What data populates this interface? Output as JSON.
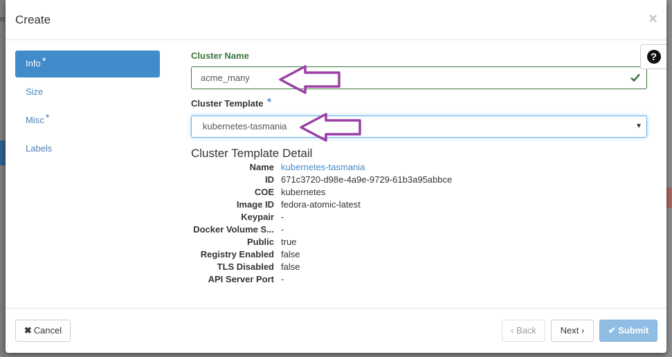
{
  "background": {
    "fragment_text": "ro"
  },
  "modal": {
    "title": "Create",
    "close_glyph": "×",
    "help_glyph": "?"
  },
  "nav": {
    "items": [
      {
        "label": "Info",
        "required": "*",
        "active": true
      },
      {
        "label": "Size",
        "required": "",
        "active": false
      },
      {
        "label": "Misc",
        "required": "*",
        "active": false
      },
      {
        "label": "Labels",
        "required": "",
        "active": false
      }
    ]
  },
  "form": {
    "cluster_name": {
      "label": "Cluster Name",
      "value": "acme_many",
      "status": "valid"
    },
    "cluster_template": {
      "label": "Cluster Template",
      "required": "*",
      "value": "kubernetes-tasmania"
    }
  },
  "detail": {
    "title": "Cluster Template Detail",
    "rows": [
      {
        "key": "Name",
        "value": "kubernetes-tasmania"
      },
      {
        "key": "ID",
        "value": "671c3720-d98e-4a9e-9729-61b3a95abbce"
      },
      {
        "key": "COE",
        "value": "kubernetes"
      },
      {
        "key": "Image ID",
        "value": "fedora-atomic-latest"
      },
      {
        "key": "Keypair",
        "value": "-"
      },
      {
        "key": "Docker Volume S...",
        "value": "-"
      },
      {
        "key": "Public",
        "value": "true"
      },
      {
        "key": "Registry Enabled",
        "value": "false"
      },
      {
        "key": "TLS Disabled",
        "value": "false"
      },
      {
        "key": "API Server Port",
        "value": "-"
      }
    ]
  },
  "footer": {
    "cancel_label": "Cancel",
    "back_label": "‹ Back",
    "next_label": "Next ›",
    "submit_label": "Submit"
  },
  "colors": {
    "primary": "#428bca",
    "success": "#3c763d",
    "annotation_arrow": "#9b3fa6"
  }
}
